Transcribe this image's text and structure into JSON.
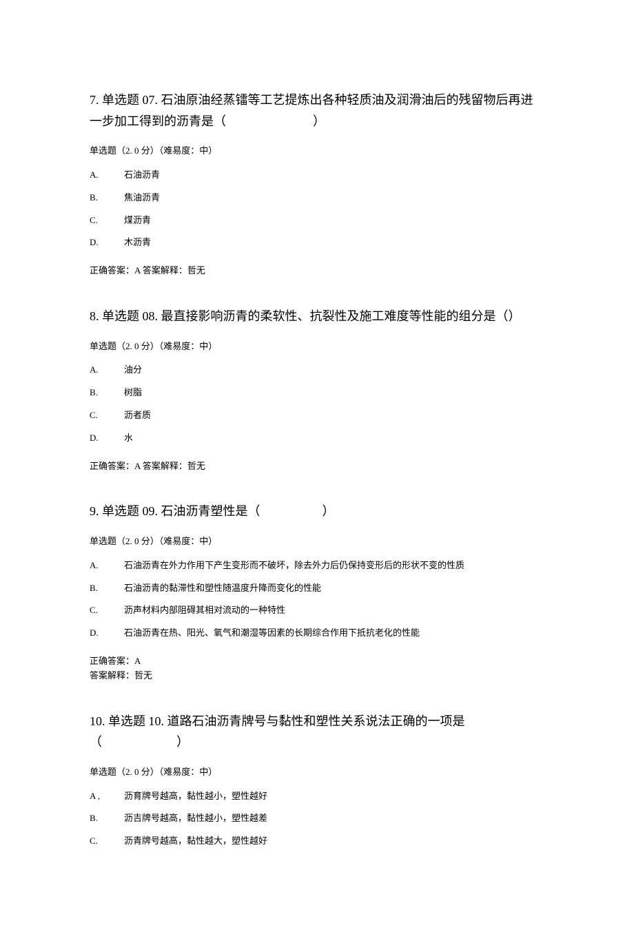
{
  "questions": [
    {
      "number": "7.",
      "title": "单选题 07. 石油原油经蒸镭等工艺提炼出各种轻质油及润滑油后的残留物后再进一步加工得到的沥青是（　　　　　　　）",
      "meta": "单选题（2. 0 分）（难易度：中）",
      "options": [
        {
          "letter": "A.",
          "text": "石油沥青"
        },
        {
          "letter": "B.",
          "text": "焦油沥青"
        },
        {
          "letter": "C.",
          "text": "煤沥青"
        },
        {
          "letter": "D.",
          "text": "木沥青"
        }
      ],
      "answer": "正确答案：A 答案解释：哲无"
    },
    {
      "number": "8.",
      "title": "单选题 08. 最直接影响沥青的柔软性、抗裂性及施工难度等性能的组分是（）",
      "meta": "单选题（2. 0 分）（难易度：中）",
      "options": [
        {
          "letter": "A.",
          "text": "油分"
        },
        {
          "letter": "B.",
          "text": "树脂"
        },
        {
          "letter": "C.",
          "text": "沥者质"
        },
        {
          "letter": "D.",
          "text": "水"
        }
      ],
      "answer": "正确答案：A 答案解释：哲无"
    },
    {
      "number": "9.",
      "title": "单选题 09. 石油沥青塑性是（　　　　　）",
      "meta": "单选题（2. 0 分）（难易度：中）",
      "options": [
        {
          "letter": "A.",
          "text": "石油沥青在外力作用下产生变形而不破坏，除去外力后仍保持变形后的形状不变的性质"
        },
        {
          "letter": "B.",
          "text": "石油沥青的黏滞性和塑性随温度升降而变化的性能"
        },
        {
          "letter": "C.",
          "text": "沥声材料内部阻碍其相对流动的一种特性"
        },
        {
          "letter": "D.",
          "text": "石油沥青在热、阳光、氧气和潮湿等因素的长期综合作用下抵抗老化的性能"
        }
      ],
      "answer": "正确答案：A\n答案解释：哲无"
    },
    {
      "number": "10.",
      "title": "单选题 10. 道路石油沥青牌号与黏性和塑性关系说法正确的一项是（　　　　　　）",
      "meta": "单选题（2. 0 分）（难易度：中）",
      "options": [
        {
          "letter": "A ,",
          "text": "沥育牌号越高，黏性越小，塑性越好"
        },
        {
          "letter": "B.",
          "text": "沥吉牌号越高，黏性越小，塑性越差"
        },
        {
          "letter": "C.",
          "text": "沥青牌号越高，黏性越大，塑性越好"
        }
      ],
      "answer": ""
    }
  ]
}
